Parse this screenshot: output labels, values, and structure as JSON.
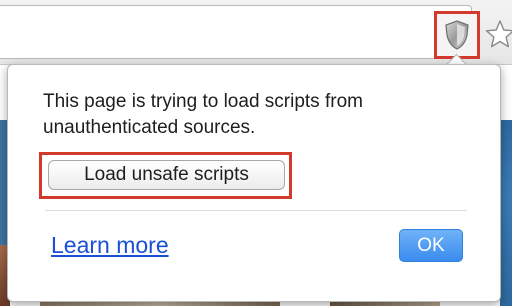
{
  "bubble": {
    "message": "This page is trying to load scripts from unauthenticated sources.",
    "load_unsafe_label": "Load unsafe scripts",
    "learn_more_label": "Learn more",
    "ok_label": "OK"
  },
  "icons": {
    "shield": "shield-icon",
    "star": "star-icon"
  },
  "colors": {
    "highlight": "#d33a2c",
    "ok_button": "#3a8cee",
    "link": "#1a4fd6"
  }
}
